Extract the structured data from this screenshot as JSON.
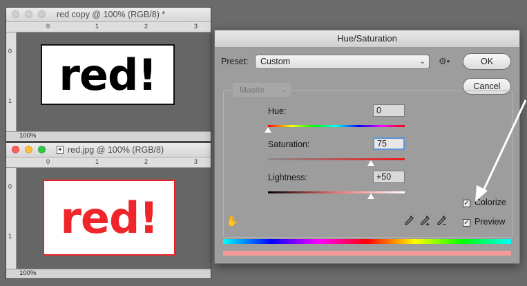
{
  "window_top": {
    "title": "red copy @ 100% (RGB/8) *",
    "zoom": "100%",
    "ruler_h": [
      "0",
      "1",
      "2",
      "3"
    ],
    "ruler_v": [
      "0",
      "1"
    ],
    "art_text": "red!",
    "art_color": "#000000"
  },
  "window_bottom": {
    "title": "red.jpg @ 100% (RGB/8)",
    "zoom": "100%",
    "ruler_h": [
      "0",
      "1",
      "2",
      "3"
    ],
    "ruler_v": [
      "0",
      "1"
    ],
    "art_text": "red!",
    "art_color": "#f0252a"
  },
  "dialog": {
    "title": "Hue/Saturation",
    "preset_label": "Preset:",
    "preset_value": "Custom",
    "ok_label": "OK",
    "cancel_label": "Cancel",
    "channel_value": "Master",
    "hue_label": "Hue:",
    "hue_value": "0",
    "saturation_label": "Saturation:",
    "saturation_value": "75",
    "lightness_label": "Lightness:",
    "lightness_value": "+50",
    "colorize_label": "Colorize",
    "colorize_checked": true,
    "preview_label": "Preview",
    "preview_checked": true,
    "hue_level": 0.0,
    "saturation_level": 0.75,
    "lightness_level": 0.75,
    "result_color": "#f59a9a"
  }
}
